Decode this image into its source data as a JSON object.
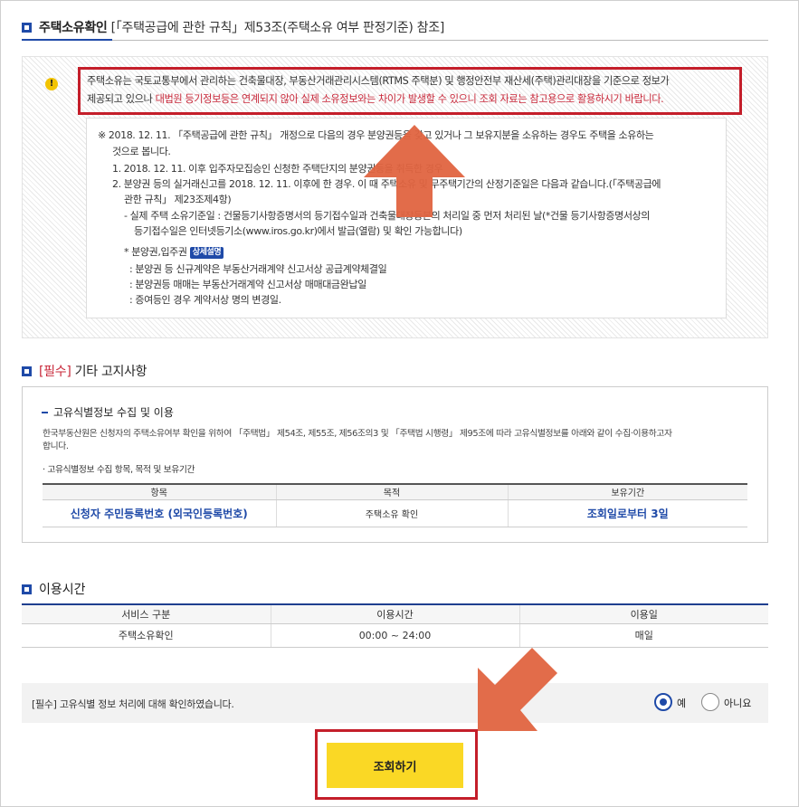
{
  "section1": {
    "title": "주택소유확인",
    "subtitle": "[「주택공급에 관한 규칙」제53조(주택소유 여부 판정기준) 참조]",
    "warning_icon": "!",
    "warning_line1": "주택소유는 국토교통부에서 관리하는 건축물대장, 부동산거래관리시스템(RTMS 주택분) 및 행정안전부 재산세(주택)관리대장을 기준으로 정보가",
    "warning_line2_a": "제공되고 있으나 ",
    "warning_line2_red": "대법원 등기정보등은 연계되지 않아 실제 소유정보와는 차이가 발생할 수 있으니 조회 자료는 참고용으로 활용하시기 바랍니다.",
    "note1": "※  2018. 12. 11. 「주택공급에 관한 규칙」 개정으로 다음의 경우 분양권등을 갖고 있거나 그 보유지분을 소유하는 경우도 주택을 소유하는",
    "note1b": "것으로 봅니다.",
    "note2": "1. 2018. 12. 11. 이후 입주자모집승인 신청한 주택단지의 분양권등을 취득한 경우",
    "note3": "2. 분양권 등의 실거래신고를 2018. 12. 11. 이후에 한 경우. 이 때 주택소유 및 무주택기간의 산정기준일은 다음과 같습니다.(「주택공급에",
    "note3b": "관한 규칙」 제23조제4항)",
    "note4": "- 실제 주택 소유기준일 : 건물등기사항증명서의 등기접수일과 건축물대장등본의 처리일 중 먼저 처리된 날(*건물 등기사항증명서상의",
    "note4b": "등기접수일은 인터넷등기소(www.iros.go.kr)에서 발급(열람) 및 확인 가능합니다)",
    "note5": "* 분양권,입주권",
    "detail_badge": "상세설명",
    "note6": ": 분양권 등 신규계약은 부동산거래계약 신고서상 공급계약체결일",
    "note7": ": 분양권등 매매는 부동산거래계약 신고서상 매매대금완납일",
    "note8": ": 증여등인 경우 계약서상 명의 변경일."
  },
  "section2": {
    "required": "[필수]",
    "title": " 기타 고지사항",
    "sub_title": "고유식별정보 수집 및 이용",
    "desc1": "한국부동산원은 신청자의 주택소유여부 확인을 위하여 「주택법」 제54조, 제55조, 제56조의3 및 「주택법 시행령」 제95조에 따라 고유식별정보를 아래와 같이 수집·이용하고자",
    "desc2": "합니다.",
    "bullet": "· 고유식별정보 수집 항목, 목적 및 보유기간",
    "table_headers": [
      "항목",
      "목적",
      "보유기간"
    ],
    "table_row": [
      "신청자 주민등록번호 (외국인등록번호)",
      "주택소유 확인",
      "조회일로부터 3일"
    ]
  },
  "section3": {
    "title": "이용시간",
    "headers": [
      "서비스 구분",
      "이용시간",
      "이용일"
    ],
    "row": [
      "주택소유확인",
      "00:00 ~ 24:00",
      "매일"
    ]
  },
  "confirm": {
    "label": "[필수] 고유식별 정보 처리에 대해 확인하였습니다.",
    "yes": "예",
    "no": "아니요",
    "selected": "예"
  },
  "submit_label": "조회하기",
  "colors": {
    "accent": "#1f4aa8",
    "highlight": "#c41e2a",
    "arrow": "#e06440",
    "button": "#fad825"
  }
}
